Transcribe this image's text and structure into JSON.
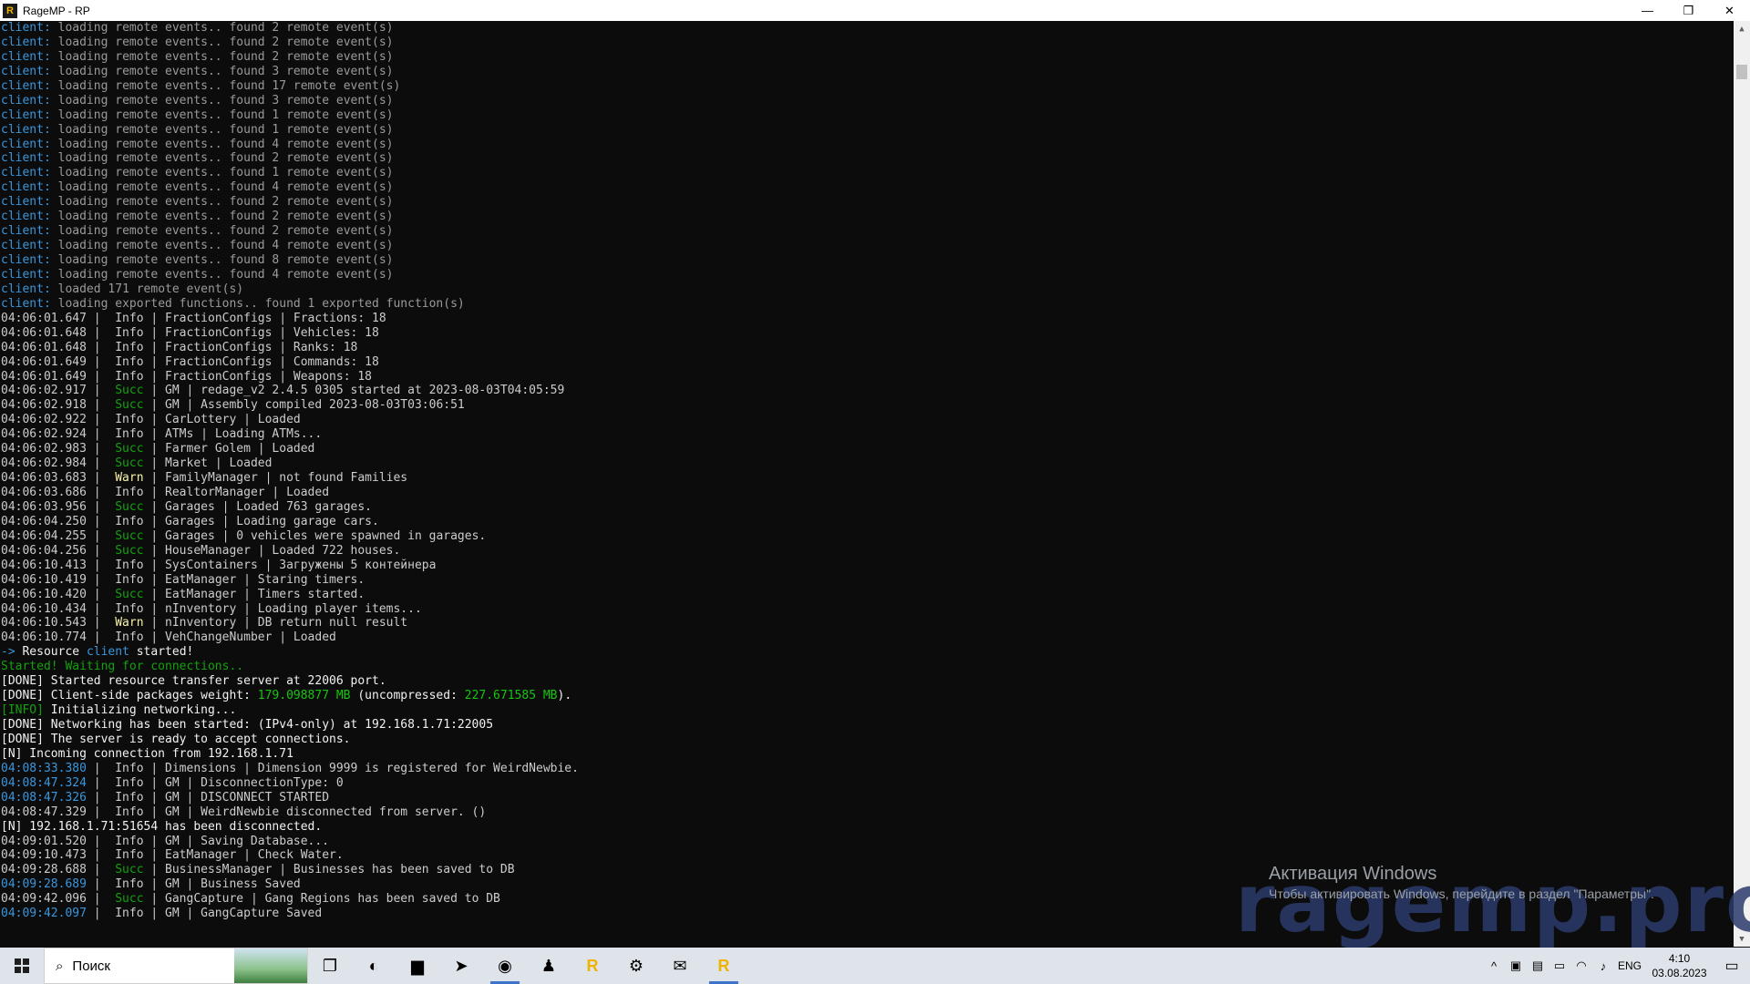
{
  "window": {
    "title": "RageMP - RP"
  },
  "console": {
    "lines": [
      [
        {
          "t": "client:",
          "c": "client"
        },
        {
          "t": " loading remote events.. found 2 remote event(s)",
          "c": "gray"
        }
      ],
      [
        {
          "t": "client:",
          "c": "client"
        },
        {
          "t": " loading remote events.. found 2 remote event(s)",
          "c": "gray"
        }
      ],
      [
        {
          "t": "client:",
          "c": "client"
        },
        {
          "t": " loading remote events.. found 2 remote event(s)",
          "c": "gray"
        }
      ],
      [
        {
          "t": "client:",
          "c": "client"
        },
        {
          "t": " loading remote events.. found 3 remote event(s)",
          "c": "gray"
        }
      ],
      [
        {
          "t": "client:",
          "c": "client"
        },
        {
          "t": " loading remote events.. found 17 remote event(s)",
          "c": "gray"
        }
      ],
      [
        {
          "t": "client:",
          "c": "client"
        },
        {
          "t": " loading remote events.. found 3 remote event(s)",
          "c": "gray"
        }
      ],
      [
        {
          "t": "client:",
          "c": "client"
        },
        {
          "t": " loading remote events.. found 1 remote event(s)",
          "c": "gray"
        }
      ],
      [
        {
          "t": "client:",
          "c": "client"
        },
        {
          "t": " loading remote events.. found 1 remote event(s)",
          "c": "gray"
        }
      ],
      [
        {
          "t": "client:",
          "c": "client"
        },
        {
          "t": " loading remote events.. found 4 remote event(s)",
          "c": "gray"
        }
      ],
      [
        {
          "t": "client:",
          "c": "client"
        },
        {
          "t": " loading remote events.. found 2 remote event(s)",
          "c": "gray"
        }
      ],
      [
        {
          "t": "client:",
          "c": "client"
        },
        {
          "t": " loading remote events.. found 1 remote event(s)",
          "c": "gray"
        }
      ],
      [
        {
          "t": "client:",
          "c": "client"
        },
        {
          "t": " loading remote events.. found 4 remote event(s)",
          "c": "gray"
        }
      ],
      [
        {
          "t": "client:",
          "c": "client"
        },
        {
          "t": " loading remote events.. found 2 remote event(s)",
          "c": "gray"
        }
      ],
      [
        {
          "t": "client:",
          "c": "client"
        },
        {
          "t": " loading remote events.. found 2 remote event(s)",
          "c": "gray"
        }
      ],
      [
        {
          "t": "client:",
          "c": "client"
        },
        {
          "t": " loading remote events.. found 2 remote event(s)",
          "c": "gray"
        }
      ],
      [
        {
          "t": "client:",
          "c": "client"
        },
        {
          "t": " loading remote events.. found 4 remote event(s)",
          "c": "gray"
        }
      ],
      [
        {
          "t": "client:",
          "c": "client"
        },
        {
          "t": " loading remote events.. found 8 remote event(s)",
          "c": "gray"
        }
      ],
      [
        {
          "t": "client:",
          "c": "client"
        },
        {
          "t": " loading remote events.. found 4 remote event(s)",
          "c": "gray"
        }
      ],
      [
        {
          "t": "client:",
          "c": "client"
        },
        {
          "t": " loaded 171 remote event(s)",
          "c": "gray"
        }
      ],
      [
        {
          "t": "client:",
          "c": "client"
        },
        {
          "t": " loading exported functions.. found 1 exported function(s)",
          "c": "gray"
        }
      ],
      [
        {
          "t": "04:06:01.647 |  ",
          "c": "info"
        },
        {
          "t": "Info",
          "c": "info"
        },
        {
          "t": " | FractionConfigs | Fractions: 18",
          "c": "info"
        }
      ],
      [
        {
          "t": "04:06:01.648 |  ",
          "c": "info"
        },
        {
          "t": "Info",
          "c": "info"
        },
        {
          "t": " | FractionConfigs | Vehicles: 18",
          "c": "info"
        }
      ],
      [
        {
          "t": "04:06:01.648 |  ",
          "c": "info"
        },
        {
          "t": "Info",
          "c": "info"
        },
        {
          "t": " | FractionConfigs | Ranks: 18",
          "c": "info"
        }
      ],
      [
        {
          "t": "04:06:01.649 |  ",
          "c": "info"
        },
        {
          "t": "Info",
          "c": "info"
        },
        {
          "t": " | FractionConfigs | Commands: 18",
          "c": "info"
        }
      ],
      [
        {
          "t": "04:06:01.649 |  ",
          "c": "info"
        },
        {
          "t": "Info",
          "c": "info"
        },
        {
          "t": " | FractionConfigs | Weapons: 18",
          "c": "info"
        }
      ],
      [
        {
          "t": "04:06:02.917 |  ",
          "c": "info"
        },
        {
          "t": "Succ",
          "c": "succ"
        },
        {
          "t": " | GM | redage_v2 2.4.5 0305 started at 2023-08-03T04:05:59",
          "c": "info"
        }
      ],
      [
        {
          "t": "04:06:02.918 |  ",
          "c": "info"
        },
        {
          "t": "Succ",
          "c": "succ"
        },
        {
          "t": " | GM | Assembly compiled 2023-08-03T03:06:51",
          "c": "info"
        }
      ],
      [
        {
          "t": "04:06:02.922 |  ",
          "c": "info"
        },
        {
          "t": "Info",
          "c": "info"
        },
        {
          "t": " | CarLottery | Loaded",
          "c": "info"
        }
      ],
      [
        {
          "t": "04:06:02.924 |  ",
          "c": "info"
        },
        {
          "t": "Info",
          "c": "info"
        },
        {
          "t": " | ATMs | Loading ATMs...",
          "c": "info"
        }
      ],
      [
        {
          "t": "04:06:02.983 |  ",
          "c": "info"
        },
        {
          "t": "Succ",
          "c": "succ"
        },
        {
          "t": " | Farmer Golem | Loaded",
          "c": "info"
        }
      ],
      [
        {
          "t": "04:06:02.984 |  ",
          "c": "info"
        },
        {
          "t": "Succ",
          "c": "succ"
        },
        {
          "t": " | Market | Loaded",
          "c": "info"
        }
      ],
      [
        {
          "t": "04:06:03.683 |  ",
          "c": "info"
        },
        {
          "t": "Warn",
          "c": "warn"
        },
        {
          "t": " | FamilyManager | not found Families",
          "c": "info"
        }
      ],
      [
        {
          "t": "04:06:03.686 |  ",
          "c": "info"
        },
        {
          "t": "Info",
          "c": "info"
        },
        {
          "t": " | RealtorManager | Loaded",
          "c": "info"
        }
      ],
      [
        {
          "t": "04:06:03.956 |  ",
          "c": "info"
        },
        {
          "t": "Succ",
          "c": "succ"
        },
        {
          "t": " | Garages | Loaded 763 garages.",
          "c": "info"
        }
      ],
      [
        {
          "t": "04:06:04.250 |  ",
          "c": "info"
        },
        {
          "t": "Info",
          "c": "info"
        },
        {
          "t": " | Garages | Loading garage cars.",
          "c": "info"
        }
      ],
      [
        {
          "t": "04:06:04.255 |  ",
          "c": "info"
        },
        {
          "t": "Succ",
          "c": "succ"
        },
        {
          "t": " | Garages | 0 vehicles were spawned in garages.",
          "c": "info"
        }
      ],
      [
        {
          "t": "04:06:04.256 |  ",
          "c": "info"
        },
        {
          "t": "Succ",
          "c": "succ"
        },
        {
          "t": " | HouseManager | Loaded 722 houses.",
          "c": "info"
        }
      ],
      [
        {
          "t": "04:06:10.413 |  ",
          "c": "info"
        },
        {
          "t": "Info",
          "c": "info"
        },
        {
          "t": " | SysContainers | Загружены 5 контейнера",
          "c": "info"
        }
      ],
      [
        {
          "t": "04:06:10.419 |  ",
          "c": "info"
        },
        {
          "t": "Info",
          "c": "info"
        },
        {
          "t": " | EatManager | Staring timers.",
          "c": "info"
        }
      ],
      [
        {
          "t": "04:06:10.420 |  ",
          "c": "info"
        },
        {
          "t": "Succ",
          "c": "succ"
        },
        {
          "t": " | EatManager | Timers started.",
          "c": "info"
        }
      ],
      [
        {
          "t": "04:06:10.434 |  ",
          "c": "info"
        },
        {
          "t": "Info",
          "c": "info"
        },
        {
          "t": " | nInventory | Loading player items...",
          "c": "info"
        }
      ],
      [
        {
          "t": "04:06:10.543 |  ",
          "c": "info"
        },
        {
          "t": "Warn",
          "c": "warn"
        },
        {
          "t": " | nInventory | DB return null result",
          "c": "info"
        }
      ],
      [
        {
          "t": "04:06:10.774 |  ",
          "c": "info"
        },
        {
          "t": "Info",
          "c": "info"
        },
        {
          "t": " | VehChangeNumber | Loaded",
          "c": "info"
        }
      ],
      [
        {
          "t": "-> ",
          "c": "client"
        },
        {
          "t": "Resource ",
          "c": "bright"
        },
        {
          "t": "client",
          "c": "client"
        },
        {
          "t": " started!",
          "c": "bright"
        }
      ],
      [
        {
          "t": "Started! Waiting for connections..",
          "c": "succ"
        }
      ],
      [
        {
          "t": "[DONE] Started resource transfer server at 22006 port.",
          "c": "bright"
        }
      ],
      [
        {
          "t": "[DONE] Client-side packages weight: ",
          "c": "bright"
        },
        {
          "t": "179.098877 MB",
          "c": "green"
        },
        {
          "t": " (uncompressed: ",
          "c": "bright"
        },
        {
          "t": "227.671585 MB",
          "c": "green"
        },
        {
          "t": ").",
          "c": "bright"
        }
      ],
      [
        {
          "t": "[INFO]",
          "c": "succ"
        },
        {
          "t": " Initializing networking...",
          "c": "bright"
        }
      ],
      [
        {
          "t": "[DONE] Networking has been started: (IPv4-only) at 192.168.1.71:22005",
          "c": "bright"
        }
      ],
      [
        {
          "t": "[DONE] The server is ready to accept connections.",
          "c": "bright"
        }
      ],
      [
        {
          "t": "[N] Incoming connection from 192.168.1.71",
          "c": "bright"
        }
      ],
      [
        {
          "t": "04:08:33.380",
          "c": "client"
        },
        {
          "t": " |  Info | Dimensions | Dimension 9999 is registered for WeirdNewbie.",
          "c": "info"
        }
      ],
      [
        {
          "t": "04:08:47.324",
          "c": "client"
        },
        {
          "t": " |  Info | GM | DisconnectionType: 0",
          "c": "info"
        }
      ],
      [
        {
          "t": "04:08:47.326",
          "c": "client"
        },
        {
          "t": " |  Info | GM | DISCONNECT STARTED",
          "c": "info"
        }
      ],
      [
        {
          "t": "04:08:47.329 |  Info | GM | WeirdNewbie disconnected from server. ()",
          "c": "info"
        }
      ],
      [
        {
          "t": "[N] 192.168.1.71:51654 has been disconnected.",
          "c": "bright"
        }
      ],
      [
        {
          "t": "04:09:01.520 |  Info | GM | Saving Database...",
          "c": "info"
        }
      ],
      [
        {
          "t": "04:09:10.473 |  Info | EatManager | Check Water.",
          "c": "info"
        }
      ],
      [
        {
          "t": "04:09:28.688 |  ",
          "c": "info"
        },
        {
          "t": "Succ",
          "c": "succ"
        },
        {
          "t": " | BusinessManager | Businesses has been saved to DB",
          "c": "info"
        }
      ],
      [
        {
          "t": "04:09:28.689",
          "c": "client"
        },
        {
          "t": " |  Info | GM | Business Saved",
          "c": "info"
        }
      ],
      [
        {
          "t": "04:09:42.096 |  ",
          "c": "info"
        },
        {
          "t": "Succ",
          "c": "succ"
        },
        {
          "t": " | GangCapture | Gang Regions has been saved to DB",
          "c": "info"
        }
      ],
      [
        {
          "t": "04:09:42.097",
          "c": "client"
        },
        {
          "t": " |  Info | GM | GangCapture Saved",
          "c": "info"
        }
      ]
    ]
  },
  "watermark": {
    "text": "ragemp.pro"
  },
  "activation": {
    "title": "Активация Windows",
    "subtitle": "Чтобы активировать Windows, перейдите в раздел \"Параметры\"."
  },
  "taskbar": {
    "search_placeholder": "Поиск",
    "apps": [
      {
        "name": "task-view-icon",
        "glyph": "❐"
      },
      {
        "name": "edge-icon",
        "glyph": "◐"
      },
      {
        "name": "folder-icon",
        "glyph": "▆"
      },
      {
        "name": "telegram-icon",
        "glyph": "➤"
      },
      {
        "name": "chrome-icon",
        "glyph": "◉"
      },
      {
        "name": "people-icon",
        "glyph": "♟"
      },
      {
        "name": "ragemp-icon",
        "glyph": "R"
      },
      {
        "name": "settings-icon",
        "glyph": "⚙"
      },
      {
        "name": "mail-icon",
        "glyph": "✉"
      },
      {
        "name": "ragemp-active-icon",
        "glyph": "R"
      }
    ],
    "tray": {
      "language": "ENG",
      "time": "4:10",
      "date": "03.08.2023"
    }
  },
  "colors": {
    "client": "#3a96dd",
    "succ": "#13a10e",
    "warn": "#f9f1a5",
    "info": "#cccccc",
    "gray": "#9a9a9a"
  }
}
